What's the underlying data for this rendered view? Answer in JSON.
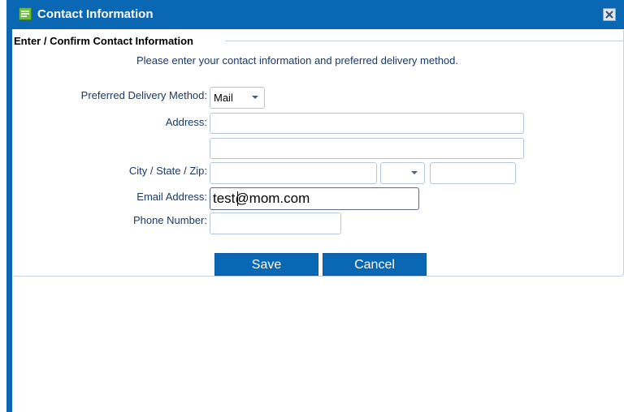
{
  "window": {
    "title": "Contact Information",
    "close_icon": "close-icon"
  },
  "section": {
    "title": "Enter / Confirm Contact Information",
    "instructions": "Please enter your contact information and preferred delivery method."
  },
  "form": {
    "delivery_label": "Preferred Delivery Method:",
    "delivery_value": "Mail",
    "address_label": "Address:",
    "address_line1": "",
    "address_line2": "",
    "city_state_zip_label": "City / State / Zip:",
    "city": "",
    "state": "",
    "zip": "",
    "email_label": "Email Address:",
    "email_value": "test@mom.com",
    "phone_label": "Phone Number:",
    "phone_value": ""
  },
  "buttons": {
    "save": "Save",
    "cancel": "Cancel"
  },
  "colors": {
    "accent": "#0a67b4",
    "label_text": "#1b3a68",
    "field_border": "#b8c8dc"
  }
}
